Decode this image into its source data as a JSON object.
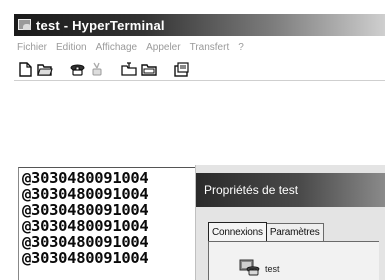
{
  "window": {
    "title": "test - HyperTerminal"
  },
  "menu": {
    "items": [
      "Fichier",
      "Edition",
      "Affichage",
      "Appeler",
      "Transfert",
      "?"
    ]
  },
  "toolbar": {
    "buttons": [
      "new-file-icon",
      "open-folder-icon",
      "call-icon",
      "disconnect-icon",
      "send-icon",
      "receive-icon",
      "properties-icon"
    ]
  },
  "terminal": {
    "lines": [
      "@3030480091004",
      "@3030480091004",
      "@3030480091004",
      "@3030480091004",
      "@3030480091004",
      "@3030480091004"
    ]
  },
  "dialog": {
    "title": "Propriétés de test",
    "tabs": [
      "Connexions",
      "Paramètres"
    ],
    "connection_name": "test"
  }
}
